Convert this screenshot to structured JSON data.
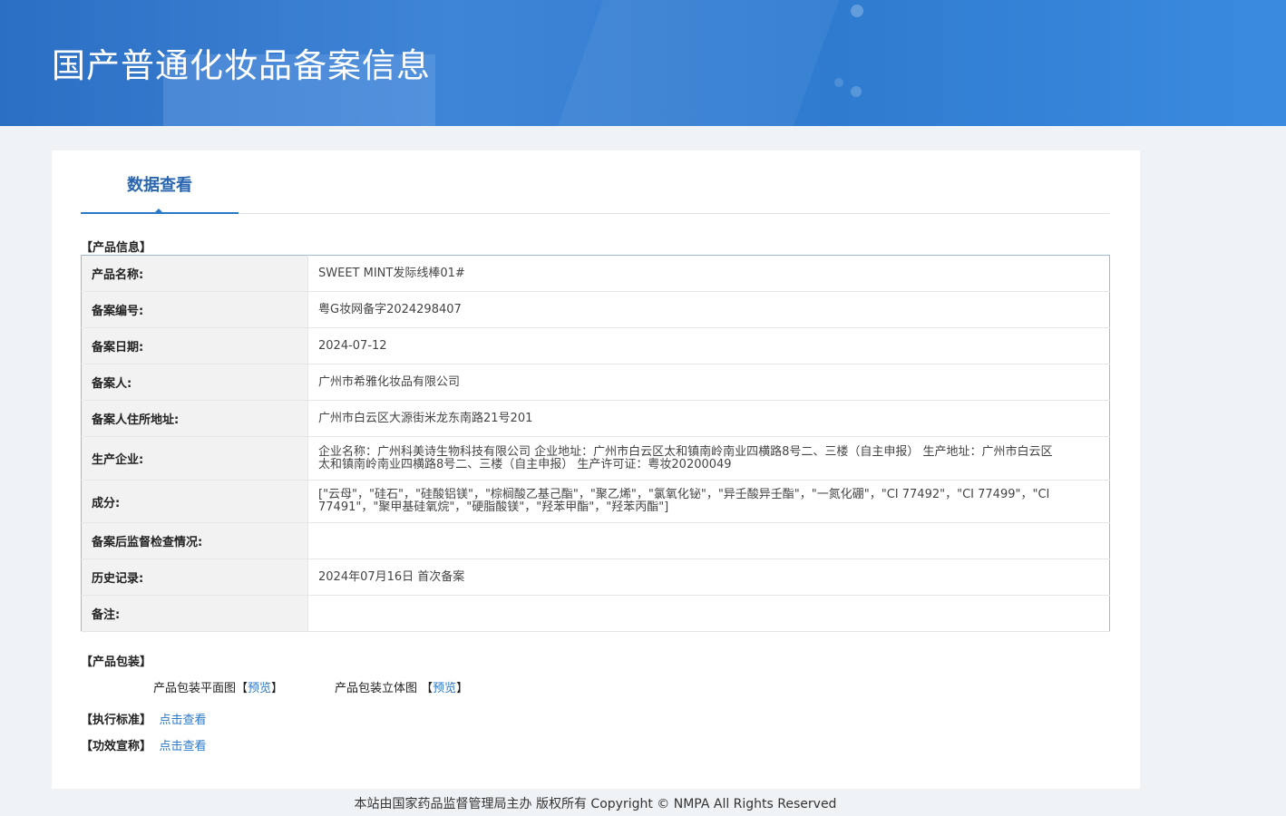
{
  "header": {
    "title": "国产普通化妆品备案信息"
  },
  "tabs": {
    "active_label": "数据查看"
  },
  "product_info": {
    "section_label": "【产品信息】",
    "rows": [
      {
        "label": "产品名称:",
        "value": "SWEET MINT发际线棒01#"
      },
      {
        "label": "备案编号:",
        "value": "粤G妆网备字2024298407"
      },
      {
        "label": "备案日期:",
        "value": "2024-07-12"
      },
      {
        "label": "备案人:",
        "value": "广州市希雅化妆品有限公司"
      },
      {
        "label": "备案人住所地址:",
        "value": "广州市白云区大源街米龙东南路21号201"
      },
      {
        "label": "生产企业:",
        "value": "企业名称：广州科美诗生物科技有限公司 企业地址：广州市白云区太和镇南岭南业四横路8号二、三楼（自主申报） 生产地址：广州市白云区太和镇南岭南业四横路8号二、三楼（自主申报） 生产许可证：粤妆20200049"
      },
      {
        "label": "成分:",
        "value": "[\"云母\"，\"硅石\"，\"硅酸铝镁\"，\"棕榈酸乙基己酯\"，\"聚乙烯\"，\"氯氧化铋\"，\"异壬酸异壬酯\"，\"一氮化硼\"，\"CI 77492\"，\"CI 77499\"，\"CI 77491\"，\"聚甲基硅氧烷\"，\"硬脂酸镁\"，\"羟苯甲酯\"，\"羟苯丙酯\"]"
      },
      {
        "label": "备案后监督检查情况:",
        "value": ""
      },
      {
        "label": "历史记录:",
        "value": "2024年07月16日 首次备案"
      },
      {
        "label": "备注:",
        "value": ""
      }
    ]
  },
  "packaging": {
    "section_label": "【产品包装】",
    "flat_label": "产品包装平面图【",
    "flat_link": "预览",
    "flat_close": "】",
    "solid_label": "产品包装立体图 【",
    "solid_link": "预览",
    "solid_close": "】"
  },
  "standard": {
    "label": "【执行标准】",
    "link": "点击查看"
  },
  "efficacy": {
    "label": "【功效宣称】",
    "link": "点击查看"
  },
  "footer": {
    "text": "本站由国家药品监督管理局主办 版权所有 Copyright © NMPA All Rights Reserved"
  }
}
